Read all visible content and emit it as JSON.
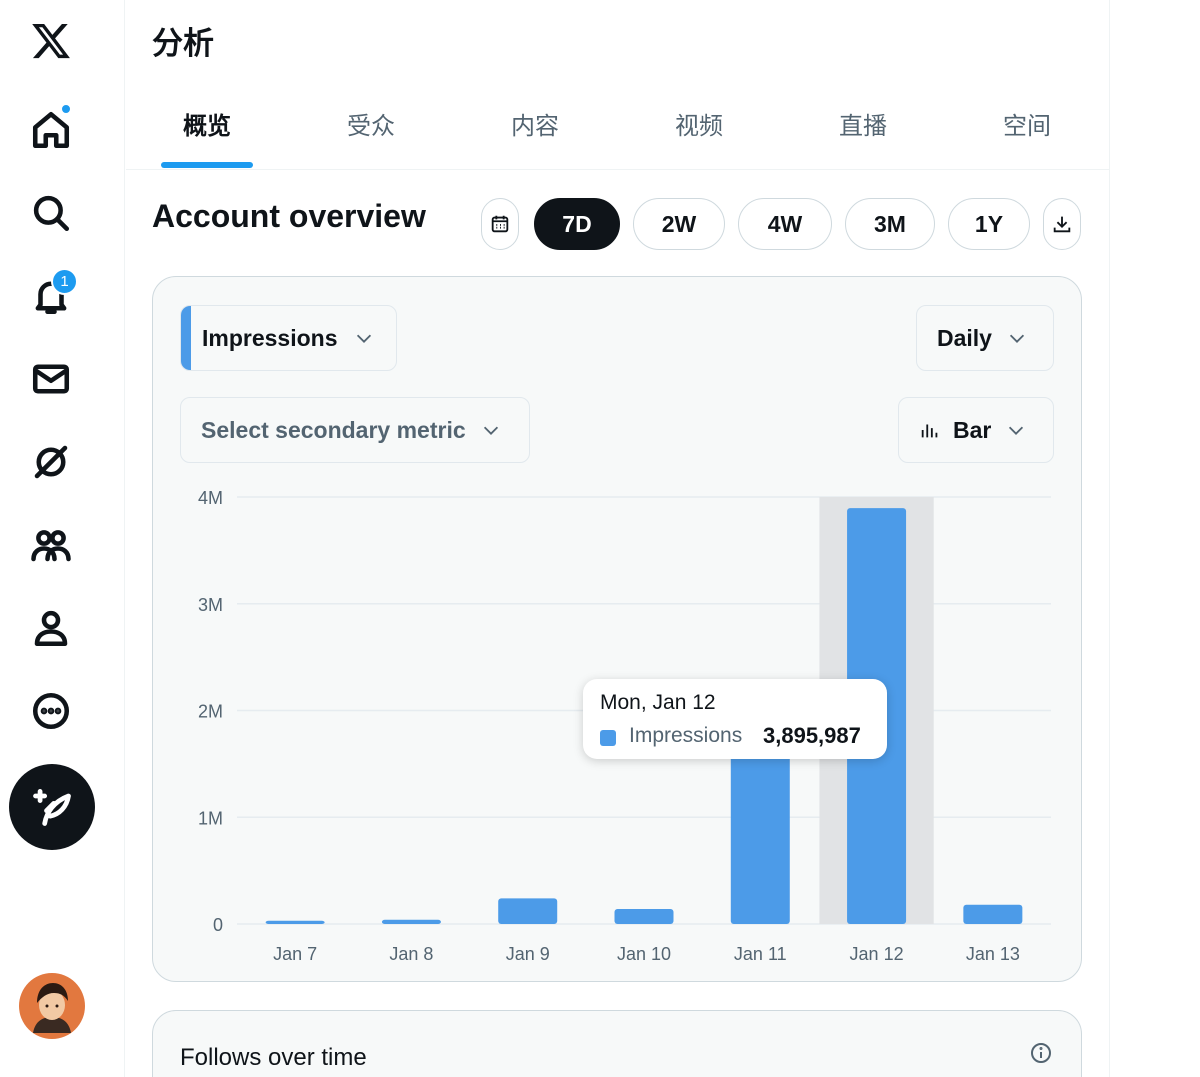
{
  "sidebar": {
    "logo": "x-logo-icon",
    "items": [
      {
        "name": "home",
        "icon": "home-icon",
        "has_dot": true
      },
      {
        "name": "explore",
        "icon": "search-icon"
      },
      {
        "name": "notifications",
        "icon": "bell-icon",
        "badge": "1"
      },
      {
        "name": "messages",
        "icon": "mail-icon"
      },
      {
        "name": "grok",
        "icon": "grok-icon"
      },
      {
        "name": "communities",
        "icon": "people-icon"
      },
      {
        "name": "profile",
        "icon": "person-icon"
      },
      {
        "name": "more",
        "icon": "more-icon"
      }
    ],
    "post_button_icon": "compose-icon",
    "avatar": "avatar"
  },
  "header": {
    "title": "分析",
    "tabs": [
      {
        "label": "概览",
        "active": true
      },
      {
        "label": "受众"
      },
      {
        "label": "内容"
      },
      {
        "label": "视频"
      },
      {
        "label": "直播"
      },
      {
        "label": "空间"
      }
    ]
  },
  "overview": {
    "title": "Account overview",
    "ranges": [
      "7D",
      "2W",
      "4W",
      "3M",
      "1Y"
    ],
    "selected_range": "7D"
  },
  "controls": {
    "primary_metric": "Impressions",
    "interval": "Daily",
    "secondary_metric": "Select secondary metric",
    "chart_type": "Bar"
  },
  "chart_data": {
    "type": "bar",
    "categories": [
      "Jan 7",
      "Jan 8",
      "Jan 9",
      "Jan 10",
      "Jan 11",
      "Jan 12",
      "Jan 13"
    ],
    "series": [
      {
        "name": "Impressions",
        "values": [
          30000,
          40000,
          240000,
          140000,
          1760000,
          3895987,
          180000
        ]
      }
    ],
    "y_ticks": [
      "0",
      "1M",
      "2M",
      "3M",
      "4M"
    ],
    "ylim": [
      0,
      4000000
    ],
    "highlighted_index": 5,
    "grid": true,
    "bar_color": "#4c9be8",
    "tooltip": {
      "date": "Mon, Jan 12",
      "series": "Impressions",
      "value": "3,895,987"
    }
  },
  "follows_card": {
    "title": "Follows over time"
  },
  "colors": {
    "accent": "#1d9bf0",
    "bar": "#4c9be8",
    "text": "#0f1419",
    "muted": "#536471"
  }
}
